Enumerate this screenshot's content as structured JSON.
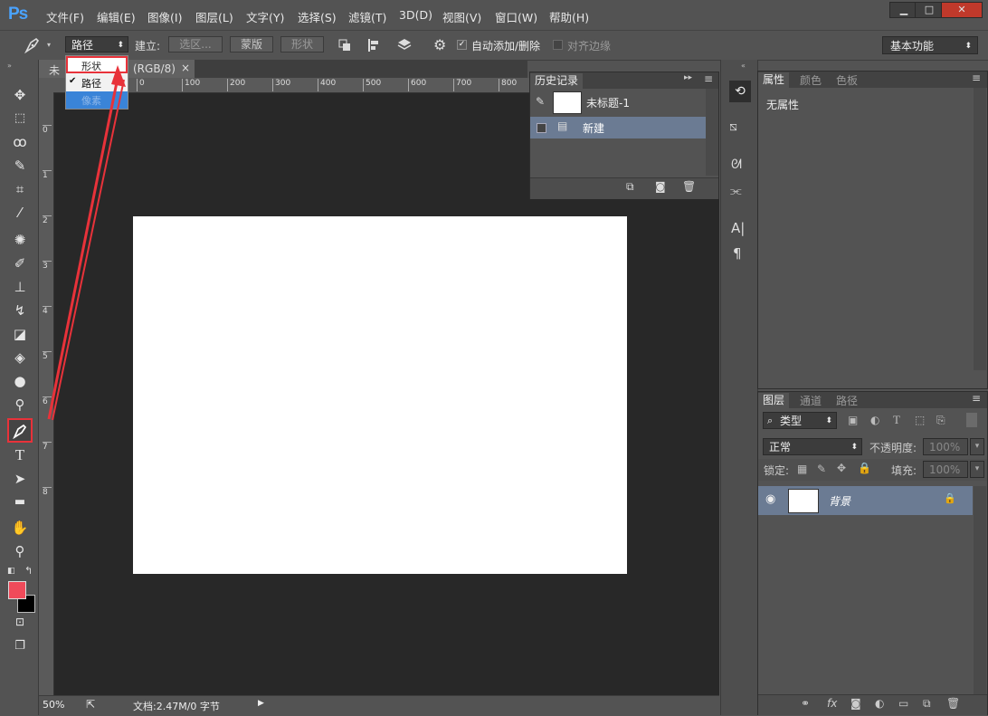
{
  "app": {
    "logo": "Ps",
    "menu": [
      "文件(F)",
      "编辑(E)",
      "图像(I)",
      "图层(L)",
      "文字(Y)",
      "选择(S)",
      "滤镜(T)",
      "3D(D)",
      "视图(V)",
      "窗口(W)",
      "帮助(H)"
    ],
    "window_controls": {
      "minimize": "▁",
      "maximize": "□",
      "close": "✕"
    }
  },
  "options_bar": {
    "tool_icon": "pen-icon",
    "mode_select": "路径",
    "build_label": "建立:",
    "selection_btn": "选区...",
    "mask_btn": "蒙版",
    "shape_btn": "形状",
    "auto_add_delete": "自动添加/删除",
    "align_edges": "对齐边缘",
    "workspace": "基本功能"
  },
  "mode_dropdown": {
    "items": [
      "形状",
      "路径",
      "像素"
    ],
    "checked_item": "路径",
    "check_mark": "✔"
  },
  "document": {
    "tab_prefix": "未",
    "tab_suffix": "(RGB/8)",
    "close": "×",
    "zoom": "50%",
    "doc_info": "文档:2.47M/0 字节"
  },
  "rulers": {
    "top": [
      "0",
      "100",
      "200",
      "300",
      "400",
      "500",
      "600",
      "700",
      "800"
    ],
    "left": [
      "0",
      "1",
      "2",
      "3",
      "4",
      "5",
      "6",
      "7",
      "8"
    ]
  },
  "history_panel": {
    "title": "历史记录",
    "snapshot_name": "未标题-1",
    "items": [
      "新建"
    ]
  },
  "properties_panel": {
    "tabs": [
      "属性",
      "颜色",
      "色板"
    ],
    "content": "无属性"
  },
  "layers_panel": {
    "tabs": [
      "图层",
      "通道",
      "路径"
    ],
    "filter_type": "类型",
    "blend_mode": "正常",
    "opacity_label": "不透明度:",
    "opacity_value": "100%",
    "lock_label": "锁定:",
    "fill_label": "填充:",
    "fill_value": "100%",
    "layers": [
      {
        "name": "背景"
      }
    ]
  },
  "colors": {
    "foreground": "#f04a5a",
    "background": "#000000",
    "highlight": "#e8323a",
    "selected_row": "#6b7b93"
  }
}
